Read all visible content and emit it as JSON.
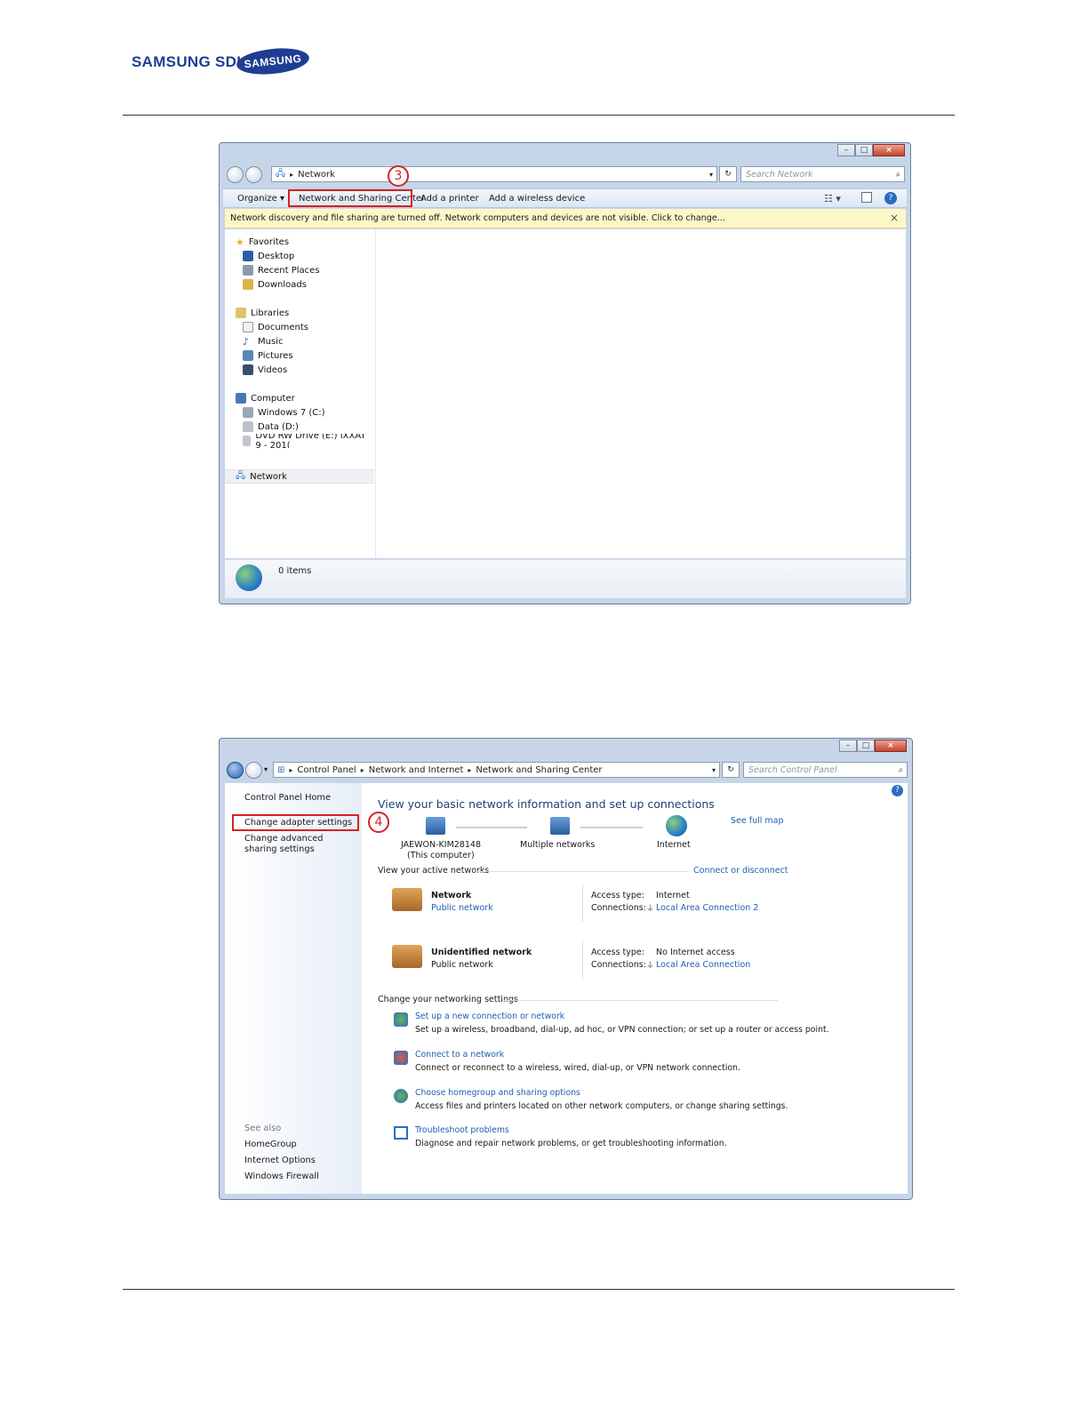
{
  "header": {
    "logo_text": "SAMSUNG SDI",
    "brand_oval_text": "SAMSUNG",
    "brand_color": "#1f3e93"
  },
  "window1": {
    "address": {
      "path": "Network"
    },
    "search_placeholder": "Search Network",
    "toolbar": {
      "organize": "Organize ▾",
      "sharing_center": "Network and Sharing Center",
      "add_printer": "Add a printer",
      "add_wireless": "Add a wireless device"
    },
    "infobar": "Network discovery and file sharing are turned off. Network computers and devices are not visible. Click to change...",
    "infobar_close": "×",
    "callout": "3",
    "nav": {
      "favorites": "Favorites",
      "desktop": "Desktop",
      "recent": "Recent Places",
      "downloads": "Downloads",
      "libraries": "Libraries",
      "documents": "Documents",
      "music": "Music",
      "pictures": "Pictures",
      "videos": "Videos",
      "computer": "Computer",
      "windows7": "Windows 7 (C:)",
      "data": "Data (D:)",
      "dvd": "DVD RW Drive (E:) IXXAT 9 - 201(",
      "network": "Network"
    },
    "status": "0 items"
  },
  "window2": {
    "breadcrumb": {
      "b1": "Control Panel",
      "b2": "Network and Internet",
      "b3": "Network and Sharing Center"
    },
    "search_placeholder": "Search Control Panel",
    "left": {
      "home": "Control Panel Home",
      "adapter": "Change adapter settings",
      "advanced": "Change advanced sharing settings",
      "see_also": "See also",
      "homegroup": "HomeGroup",
      "internet_options": "Internet Options",
      "firewall": "Windows Firewall"
    },
    "callout": "4",
    "title": "View your basic network information and set up connections",
    "map": {
      "computer": "JAEWON-KIM28148",
      "computer_sub": "(This computer)",
      "multiple": "Multiple networks",
      "internet": "Internet",
      "see_full": "See full map"
    },
    "active": {
      "heading": "View your active networks",
      "connect": "Connect or disconnect"
    },
    "net1": {
      "name": "Network",
      "type": "Public network",
      "access_label": "Access type:",
      "access": "Internet",
      "conn_label": "Connections:",
      "conn": "Local Area Connection 2"
    },
    "net2": {
      "name": "Unidentified network",
      "type": "Public network",
      "access_label": "Access type:",
      "access": "No Internet access",
      "conn_label": "Connections:",
      "conn": "Local Area Connection"
    },
    "settings": {
      "heading": "Change your networking settings",
      "s1_link": "Set up a new connection or network",
      "s1_desc": "Set up a wireless, broadband, dial-up, ad hoc, or VPN connection; or set up a router or access point.",
      "s2_link": "Connect to a network",
      "s2_desc": "Connect or reconnect to a wireless, wired, dial-up, or VPN network connection.",
      "s3_link": "Choose homegroup and sharing options",
      "s3_desc": "Access files and printers located on other network computers, or change sharing settings.",
      "s4_link": "Troubleshoot problems",
      "s4_desc": "Diagnose and repair network problems, or get troubleshooting information."
    }
  },
  "colors": {
    "callout_red": "#d52222",
    "link_blue": "#1f5fb0",
    "infobar_yellow": "#fdf7c7"
  }
}
